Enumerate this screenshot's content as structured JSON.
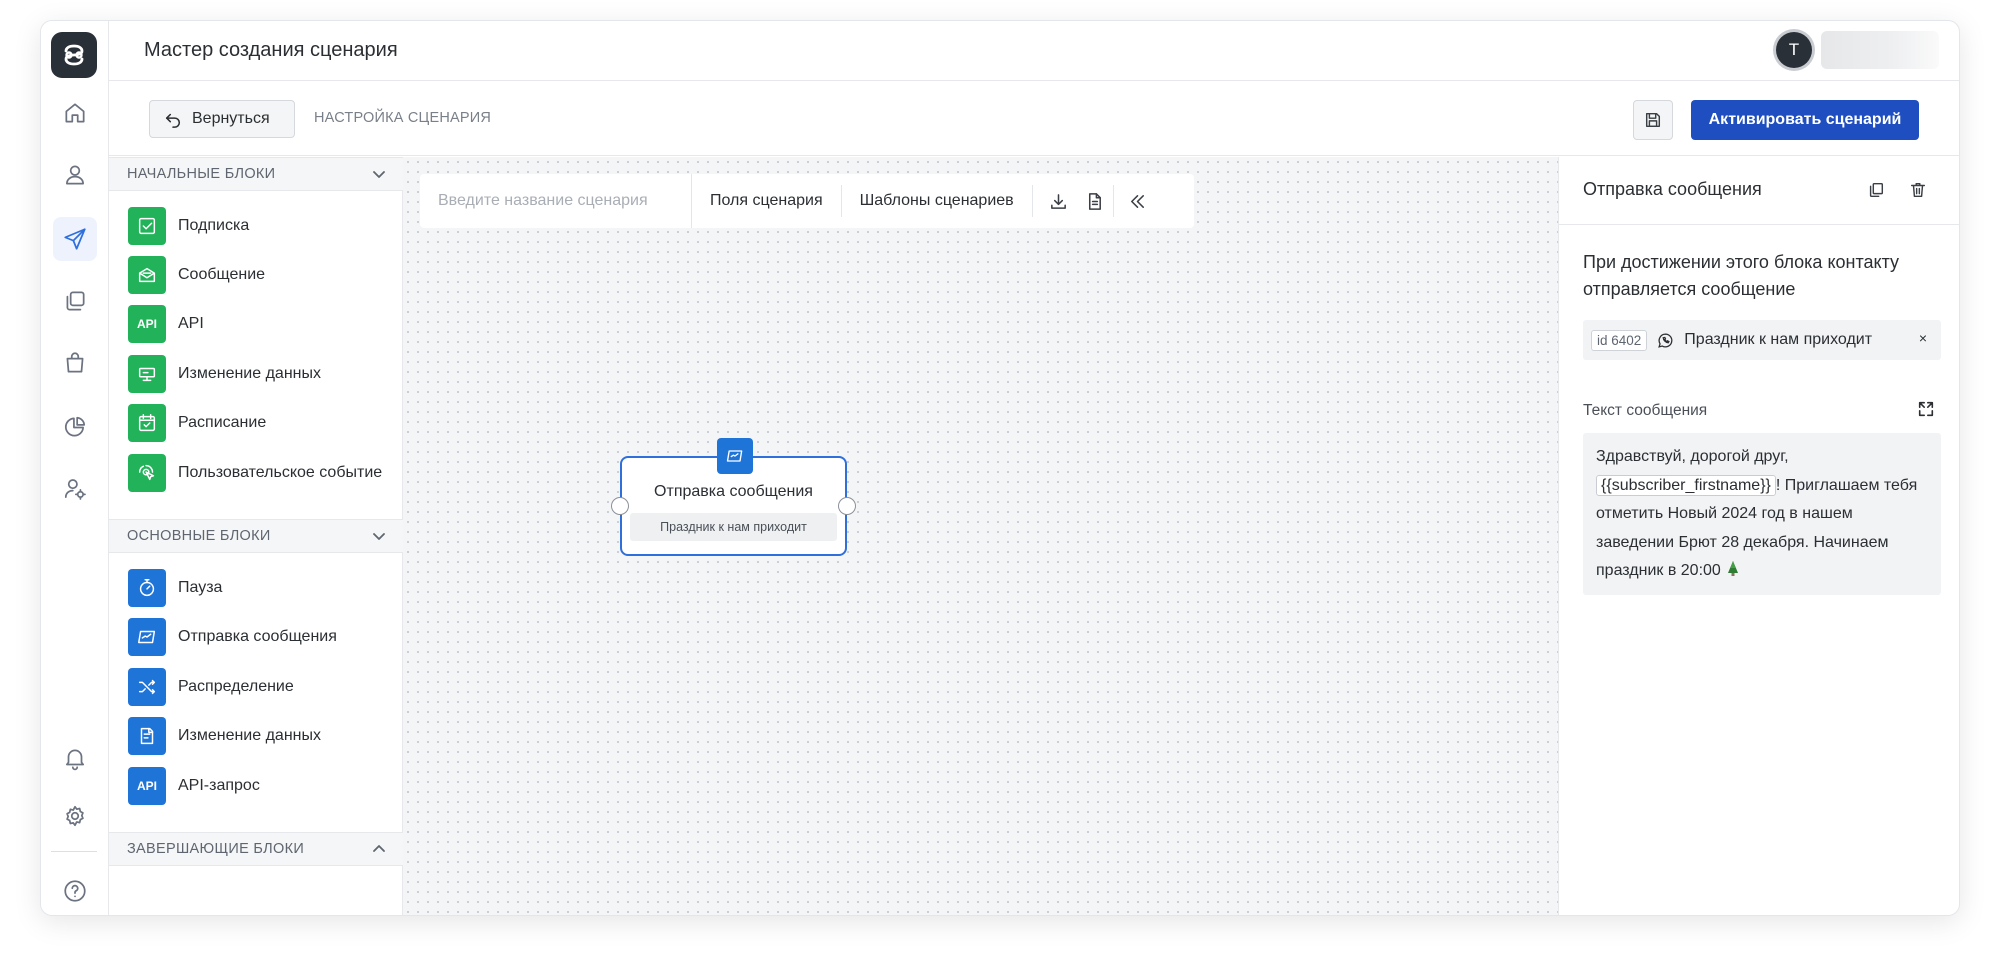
{
  "header": {
    "title": "Мастер создания сценария",
    "avatar_letter": "T"
  },
  "subbar": {
    "back_label": "Вернуться",
    "breadcrumb": "НАСТРОЙКА СЦЕНАРИЯ",
    "activate_label": "Активировать сценарий"
  },
  "nav": {
    "items": [
      "home-icon",
      "user-icon",
      "send-icon",
      "copy-icon",
      "bag-icon",
      "chart-icon",
      "user-settings-icon",
      "bell-icon",
      "gear-icon",
      "help-icon"
    ],
    "active": "send-icon",
    "accent": "#2f6fdc"
  },
  "blocks": {
    "start": {
      "title": "НАЧАЛЬНЫЕ БЛОКИ",
      "items": [
        {
          "label": "Подписка",
          "icon": "checkbox-icon"
        },
        {
          "label": "Сообщение",
          "icon": "envelope-open-icon"
        },
        {
          "label": "API",
          "icon": "api-icon"
        },
        {
          "label": "Изменение данных",
          "icon": "data-edit-icon"
        },
        {
          "label": "Расписание",
          "icon": "calendar-icon"
        },
        {
          "label": "Пользовательское событие",
          "icon": "tap-icon"
        }
      ],
      "color": "#22b35a"
    },
    "main": {
      "title": "ОСНОВНЫЕ БЛОКИ",
      "items": [
        {
          "label": "Пауза",
          "icon": "stopwatch-icon"
        },
        {
          "label": "Отправка сообщения",
          "icon": "send-message-icon"
        },
        {
          "label": "Распределение",
          "icon": "shuffle-icon"
        },
        {
          "label": "Изменение данных",
          "icon": "data-edit-icon"
        },
        {
          "label": "API-запрос",
          "icon": "api-icon"
        }
      ],
      "color": "#1f74d8"
    },
    "end": {
      "title": "ЗАВЕРШАЮЩИЕ БЛОКИ"
    },
    "api_icon_text": "API"
  },
  "canvas": {
    "name_placeholder": "Введите название сценария",
    "fields_label": "Поля сценария",
    "templates_label": "Шаблоны сценариев",
    "node": {
      "title": "Отправка сообщения",
      "subtitle": "Праздник к нам приходит"
    }
  },
  "panel": {
    "title": "Отправка сообщения",
    "description": "При достижении этого блока контакту отправляется сообщение",
    "message": {
      "id": "id 6402",
      "name": "Праздник к нам приходит",
      "close": "×"
    },
    "text_label": "Текст сообщения",
    "text_before": "Здравствуй, дорогой друг, ",
    "text_variable": "{{subscriber_firstname}}",
    "text_after": "! Приглашаем тебя отметить Новый 2024 год в нашем заведении Брют 28 декабря. Начинаем праздник в 20:00 "
  },
  "colors": {
    "primary_button": "#1f4ec1",
    "node_border": "#2f6fdc"
  }
}
